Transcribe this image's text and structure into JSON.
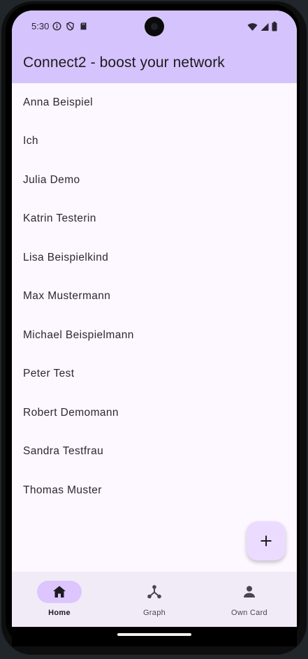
{
  "status_bar": {
    "time": "5:30",
    "left_icons": [
      "info-circle-icon",
      "shield-icon",
      "sd-card-icon"
    ],
    "right_icons": [
      "wifi-icon",
      "signal-icon",
      "battery-icon"
    ]
  },
  "app_bar": {
    "title": "Connect2 - boost your network"
  },
  "contacts": [
    "Anna Beispiel",
    "Ich",
    "Julia Demo",
    "Katrin Testerin",
    "Lisa Beispielkind",
    "Max Mustermann",
    "Michael Beispielmann",
    "Peter Test",
    "Robert Demomann",
    "Sandra Testfrau",
    "Thomas Muster"
  ],
  "fab": {
    "icon": "plus-icon"
  },
  "bottom_nav": {
    "items": [
      {
        "label": "Home",
        "icon": "home-icon",
        "active": true
      },
      {
        "label": "Graph",
        "icon": "graph-icon",
        "active": false
      },
      {
        "label": "Own Card",
        "icon": "person-icon",
        "active": false
      }
    ]
  },
  "colors": {
    "app_bar": "#d5c3fd",
    "background": "#fdf7ff",
    "fab": "#ebdcff",
    "nav_bar": "#f1ebf7",
    "nav_active_pill": "#dcc6fd",
    "text": "#1d1b20"
  }
}
